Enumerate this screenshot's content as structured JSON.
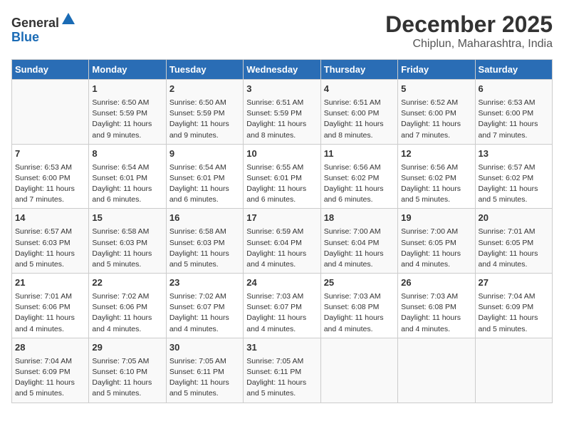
{
  "header": {
    "logo_line1": "General",
    "logo_line2": "Blue",
    "month": "December 2025",
    "location": "Chiplun, Maharashtra, India"
  },
  "days_of_week": [
    "Sunday",
    "Monday",
    "Tuesday",
    "Wednesday",
    "Thursday",
    "Friday",
    "Saturday"
  ],
  "weeks": [
    [
      {
        "day": "",
        "content": ""
      },
      {
        "day": "1",
        "content": "Sunrise: 6:50 AM\nSunset: 5:59 PM\nDaylight: 11 hours\nand 9 minutes."
      },
      {
        "day": "2",
        "content": "Sunrise: 6:50 AM\nSunset: 5:59 PM\nDaylight: 11 hours\nand 9 minutes."
      },
      {
        "day": "3",
        "content": "Sunrise: 6:51 AM\nSunset: 5:59 PM\nDaylight: 11 hours\nand 8 minutes."
      },
      {
        "day": "4",
        "content": "Sunrise: 6:51 AM\nSunset: 6:00 PM\nDaylight: 11 hours\nand 8 minutes."
      },
      {
        "day": "5",
        "content": "Sunrise: 6:52 AM\nSunset: 6:00 PM\nDaylight: 11 hours\nand 7 minutes."
      },
      {
        "day": "6",
        "content": "Sunrise: 6:53 AM\nSunset: 6:00 PM\nDaylight: 11 hours\nand 7 minutes."
      }
    ],
    [
      {
        "day": "7",
        "content": "Sunrise: 6:53 AM\nSunset: 6:00 PM\nDaylight: 11 hours\nand 7 minutes."
      },
      {
        "day": "8",
        "content": "Sunrise: 6:54 AM\nSunset: 6:01 PM\nDaylight: 11 hours\nand 6 minutes."
      },
      {
        "day": "9",
        "content": "Sunrise: 6:54 AM\nSunset: 6:01 PM\nDaylight: 11 hours\nand 6 minutes."
      },
      {
        "day": "10",
        "content": "Sunrise: 6:55 AM\nSunset: 6:01 PM\nDaylight: 11 hours\nand 6 minutes."
      },
      {
        "day": "11",
        "content": "Sunrise: 6:56 AM\nSunset: 6:02 PM\nDaylight: 11 hours\nand 6 minutes."
      },
      {
        "day": "12",
        "content": "Sunrise: 6:56 AM\nSunset: 6:02 PM\nDaylight: 11 hours\nand 5 minutes."
      },
      {
        "day": "13",
        "content": "Sunrise: 6:57 AM\nSunset: 6:02 PM\nDaylight: 11 hours\nand 5 minutes."
      }
    ],
    [
      {
        "day": "14",
        "content": "Sunrise: 6:57 AM\nSunset: 6:03 PM\nDaylight: 11 hours\nand 5 minutes."
      },
      {
        "day": "15",
        "content": "Sunrise: 6:58 AM\nSunset: 6:03 PM\nDaylight: 11 hours\nand 5 minutes."
      },
      {
        "day": "16",
        "content": "Sunrise: 6:58 AM\nSunset: 6:03 PM\nDaylight: 11 hours\nand 5 minutes."
      },
      {
        "day": "17",
        "content": "Sunrise: 6:59 AM\nSunset: 6:04 PM\nDaylight: 11 hours\nand 4 minutes."
      },
      {
        "day": "18",
        "content": "Sunrise: 7:00 AM\nSunset: 6:04 PM\nDaylight: 11 hours\nand 4 minutes."
      },
      {
        "day": "19",
        "content": "Sunrise: 7:00 AM\nSunset: 6:05 PM\nDaylight: 11 hours\nand 4 minutes."
      },
      {
        "day": "20",
        "content": "Sunrise: 7:01 AM\nSunset: 6:05 PM\nDaylight: 11 hours\nand 4 minutes."
      }
    ],
    [
      {
        "day": "21",
        "content": "Sunrise: 7:01 AM\nSunset: 6:06 PM\nDaylight: 11 hours\nand 4 minutes."
      },
      {
        "day": "22",
        "content": "Sunrise: 7:02 AM\nSunset: 6:06 PM\nDaylight: 11 hours\nand 4 minutes."
      },
      {
        "day": "23",
        "content": "Sunrise: 7:02 AM\nSunset: 6:07 PM\nDaylight: 11 hours\nand 4 minutes."
      },
      {
        "day": "24",
        "content": "Sunrise: 7:03 AM\nSunset: 6:07 PM\nDaylight: 11 hours\nand 4 minutes."
      },
      {
        "day": "25",
        "content": "Sunrise: 7:03 AM\nSunset: 6:08 PM\nDaylight: 11 hours\nand 4 minutes."
      },
      {
        "day": "26",
        "content": "Sunrise: 7:03 AM\nSunset: 6:08 PM\nDaylight: 11 hours\nand 4 minutes."
      },
      {
        "day": "27",
        "content": "Sunrise: 7:04 AM\nSunset: 6:09 PM\nDaylight: 11 hours\nand 5 minutes."
      }
    ],
    [
      {
        "day": "28",
        "content": "Sunrise: 7:04 AM\nSunset: 6:09 PM\nDaylight: 11 hours\nand 5 minutes."
      },
      {
        "day": "29",
        "content": "Sunrise: 7:05 AM\nSunset: 6:10 PM\nDaylight: 11 hours\nand 5 minutes."
      },
      {
        "day": "30",
        "content": "Sunrise: 7:05 AM\nSunset: 6:11 PM\nDaylight: 11 hours\nand 5 minutes."
      },
      {
        "day": "31",
        "content": "Sunrise: 7:05 AM\nSunset: 6:11 PM\nDaylight: 11 hours\nand 5 minutes."
      },
      {
        "day": "",
        "content": ""
      },
      {
        "day": "",
        "content": ""
      },
      {
        "day": "",
        "content": ""
      }
    ]
  ]
}
